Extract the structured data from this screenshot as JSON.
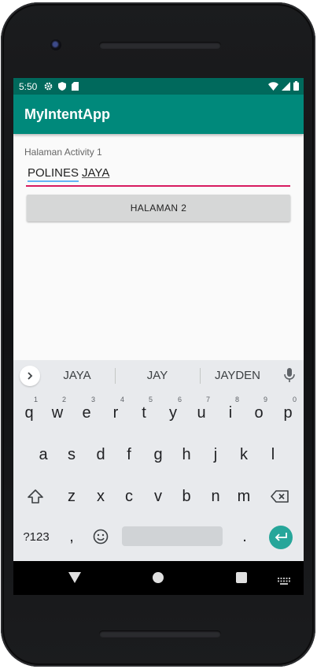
{
  "status_bar": {
    "time": "5:50",
    "icons": [
      "gear-icon",
      "shield-icon",
      "sd-card-icon",
      "wifi-icon",
      "signal-icon",
      "battery-icon"
    ]
  },
  "app_bar": {
    "title": "MyIntentApp"
  },
  "content": {
    "label": "Halaman Activity 1",
    "input_word1": "POLINES",
    "input_word2": "JAYA",
    "button_label": "HALAMAN 2"
  },
  "keyboard": {
    "suggestions": [
      "JAYA",
      "JAY",
      "JAYDEN"
    ],
    "row1": [
      {
        "k": "q",
        "h": "1"
      },
      {
        "k": "w",
        "h": "2"
      },
      {
        "k": "e",
        "h": "3"
      },
      {
        "k": "r",
        "h": "4"
      },
      {
        "k": "t",
        "h": "5"
      },
      {
        "k": "y",
        "h": "6"
      },
      {
        "k": "u",
        "h": "7"
      },
      {
        "k": "i",
        "h": "8"
      },
      {
        "k": "o",
        "h": "9"
      },
      {
        "k": "p",
        "h": "0"
      }
    ],
    "row2": [
      "a",
      "s",
      "d",
      "f",
      "g",
      "h",
      "j",
      "k",
      "l"
    ],
    "row3": [
      "z",
      "x",
      "c",
      "v",
      "b",
      "n",
      "m"
    ],
    "symbols_key": "?123",
    "comma_key": ",",
    "period_key": "."
  },
  "colors": {
    "status_bar": "#00695c",
    "app_bar": "#00897b",
    "input_underline": "#d81b60",
    "enter_key": "#26a69a"
  }
}
